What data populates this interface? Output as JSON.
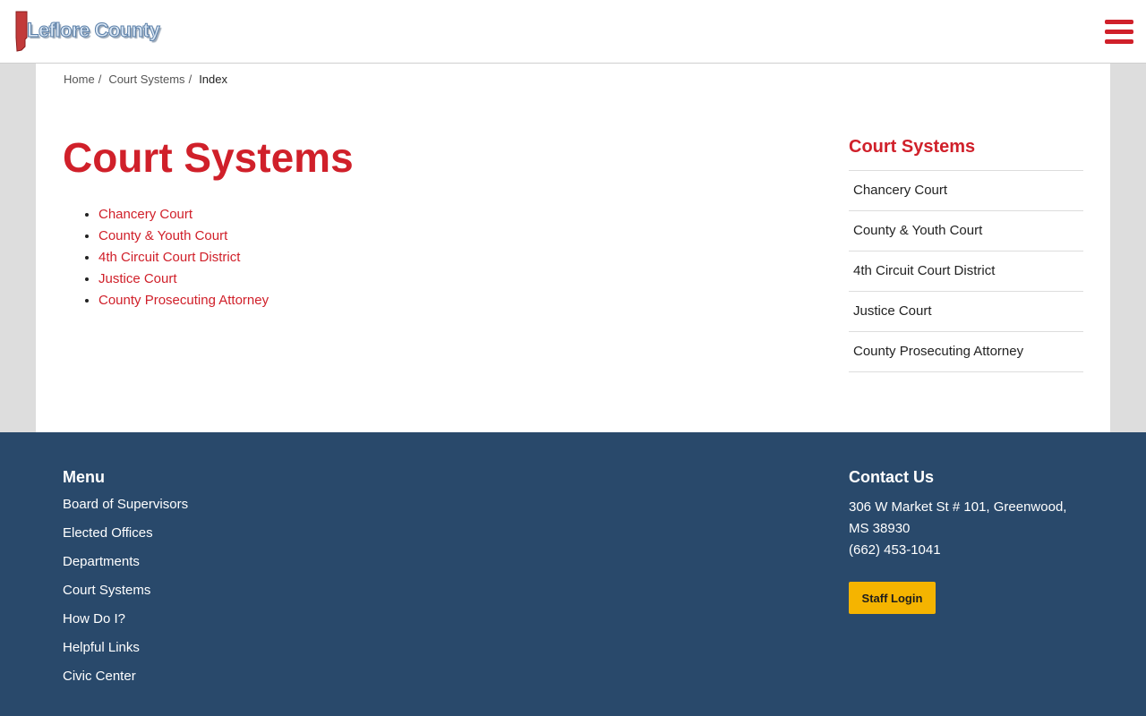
{
  "header": {
    "logo_text": "Leflore County",
    "menu_icon": "hamburger-menu-icon",
    "accent_color": "#d0202a"
  },
  "breadcrumb": {
    "items": [
      "Home",
      "Court Systems"
    ],
    "current": "Index",
    "separator": "/"
  },
  "main": {
    "title": "Court Systems",
    "links": [
      "Chancery Court",
      "County & Youth Court",
      "4th Circuit Court District",
      "Justice Court",
      "County Prosecuting Attorney"
    ]
  },
  "sidebar": {
    "title": "Court Systems",
    "items": [
      "Chancery Court",
      "County & Youth Court",
      "4th Circuit Court District",
      "Justice Court",
      "County Prosecuting Attorney"
    ]
  },
  "footer": {
    "menu_title": "Menu",
    "menu_items": [
      "Board of Supervisors",
      "Elected Offices",
      "Departments",
      "Court Systems",
      "How Do I?",
      "Helpful Links",
      "Civic Center"
    ],
    "contact_title": "Contact Us",
    "address": "306 W Market St # 101, Greenwood, MS 38930",
    "phone": "(662) 453-1041",
    "staff_login_label": "Staff Login",
    "background_color": "#29496b",
    "button_color": "#f5b400"
  }
}
